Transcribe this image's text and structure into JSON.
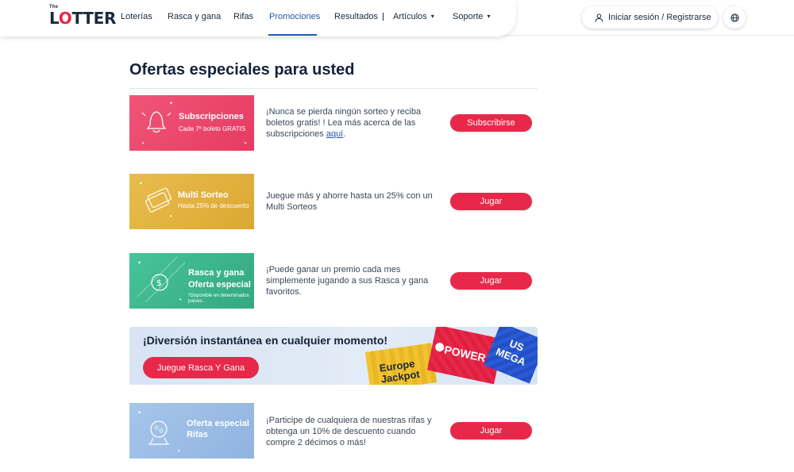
{
  "header": {
    "logo_the": "The",
    "logo_l": "L",
    "logo_o": "O",
    "logo_rest": "TTER",
    "nav": [
      {
        "label": "Loterías"
      },
      {
        "label": "Rasca y gana"
      },
      {
        "label": "Rifas"
      },
      {
        "label": "Promociones"
      },
      {
        "label": "Resultados"
      },
      {
        "label": "Artículos"
      },
      {
        "label": "Soporte"
      }
    ],
    "login_label": "Iniciar sesión / Registrarse"
  },
  "main": {
    "title": "Ofertas especiales para usted",
    "promos": [
      {
        "img_title": "Subscripciones",
        "img_sub": "Cada 7º boleto GRATIS",
        "desc": "¡Nunca se pierda ningún sorteo y reciba boletos gratis! ! Lea más acerca de las subscripciones ",
        "link": "aquí",
        "desc_end": ".",
        "button": "Subscribirse"
      },
      {
        "img_title": "Multi Sorteo",
        "img_sub": "Hasta 25% de descuento",
        "desc": "Juegue más y ahorre hasta un 25% con un Multi Sorteos",
        "button": "Jugar"
      },
      {
        "img_title": "Rasca y gana",
        "img_sub": "Oferta especial",
        "img_note": "*Disponible en determinados países.",
        "desc": "¡Puede ganar un premio cada mes simplemente jugando a sus Rasca y gana favoritos.",
        "button": "Jugar"
      },
      {
        "img_title": "Oferta especial",
        "img_sub": "Rifas",
        "desc": "¡Participe de cualquiera de nuestras rifas y obtenga un 10% de descuento cuando compre 2 décimos o más!",
        "button": "Jugar"
      }
    ],
    "banner": {
      "title": "¡Diversión instantánea en cualquier momento!",
      "button": "Juegue Rasca Y Gana",
      "card_europe_1": "Europe",
      "card_europe_2": "Jackpot",
      "card_power": "POWER",
      "card_us": "US",
      "card_mega": "MEGA"
    }
  },
  "colors": {
    "accent": "#e8284a",
    "link": "#1e5aa8",
    "subscriptions": "#ec4a6e",
    "multi": "#e2b13c",
    "scratch": "#3cb38e",
    "raffle": "#9fc0e6"
  }
}
